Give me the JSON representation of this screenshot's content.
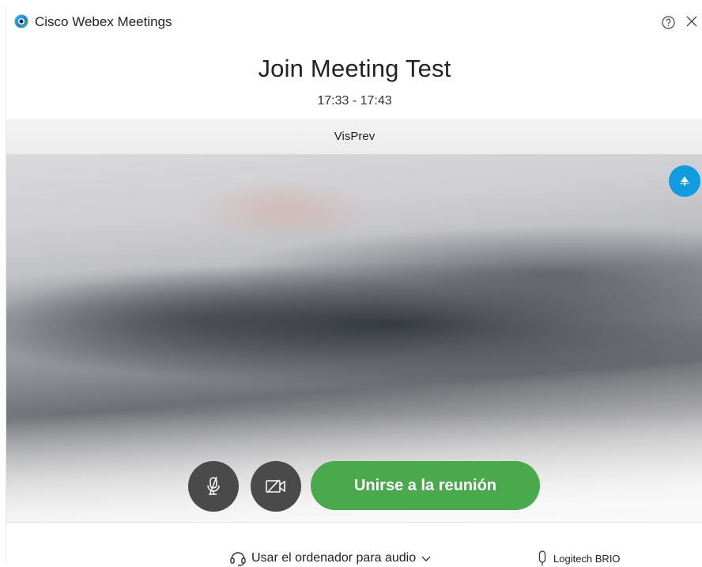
{
  "app": {
    "title": "Cisco Webex Meetings",
    "logo_icon": "webex-logo-icon",
    "help_icon": "help-icon",
    "close_icon": "close-icon"
  },
  "meeting": {
    "title": "Join Meeting Test",
    "time": "17:33 - 17:43",
    "participant_name": "VisPrev"
  },
  "controls": {
    "join_label": "Unirse a la reunión",
    "mute_icon": "microphone-muted-icon",
    "video_icon": "camera-off-icon",
    "corner_icon": "virtual-background-icon"
  },
  "audio": {
    "connection_label": "Usar el ordenador para audio",
    "headset_icon": "headset-icon",
    "chevron_icon": "chevron-down-icon",
    "device_label": "Logitech BRIO",
    "mic_icon": "microphone-icon"
  },
  "colors": {
    "join_green": "#4aa84d",
    "accent_blue": "#129ce0",
    "dark_button": "#4a4a4a"
  }
}
